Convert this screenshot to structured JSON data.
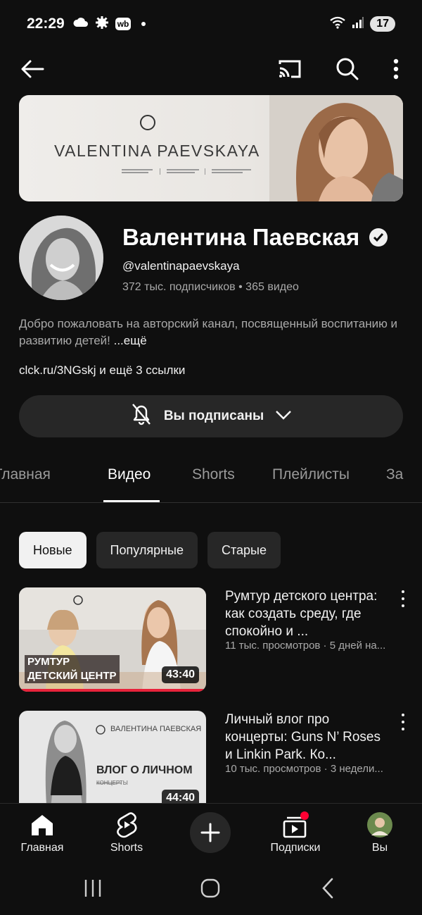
{
  "status_bar": {
    "time": "22:29",
    "wb_label": "wb",
    "battery": "17",
    "network": "5"
  },
  "topbar": {
    "icons": [
      "back-arrow-icon",
      "cast-icon",
      "search-icon",
      "more-vert-icon"
    ]
  },
  "banner": {
    "name": "VALENTINA  PAEVSKAYA"
  },
  "channel": {
    "name": "Валентина Паевская",
    "handle": "@valentinapaevskaya",
    "stats": "372 тыс. подписчиков • 365 видео",
    "description": "Добро пожаловать на авторский канал, посвященный воспитанию и развитию детей! ",
    "description_more": "...ещё",
    "links": "clck.ru/3NGskj и ещё 3 ссылки",
    "subscribe_label": "Вы подписаны"
  },
  "tabs": [
    "Главная",
    "Видео",
    "Shorts",
    "Плейлисты",
    "За"
  ],
  "active_tab": "Видео",
  "chips": [
    "Новые",
    "Популярные",
    "Старые"
  ],
  "videos": [
    {
      "title": "Румтур детского центра: как создать среду, где спокойно и ...",
      "meta": "11 тыс. просмотров · 5 дней на...",
      "duration": "43:40",
      "thumb_caption_1": "РУМТУР",
      "thumb_caption_2": "ДЕТСКИЙ ЦЕНТР",
      "watched_fraction": 1.0
    },
    {
      "title": "Личный влог про концерты: Guns N’ Roses и Linkin Park. Ко...",
      "meta": "10 тыс. просмотров · 3 недели...",
      "duration": "44:40",
      "thumb_brand": "ВАЛЕНТИНА  ПАЕВСКАЯ",
      "thumb_title": "ВЛОГ О ЛИЧНОМ",
      "thumb_subtitle": "КОНЦЕРТЫ"
    }
  ],
  "bottom_nav": {
    "home": "Главная",
    "shorts": "Shorts",
    "subscriptions": "Подписки",
    "you": "Вы"
  },
  "colors": {
    "background": "#0f0f0f",
    "surface": "#272727",
    "accent_red": "#e8223a"
  }
}
